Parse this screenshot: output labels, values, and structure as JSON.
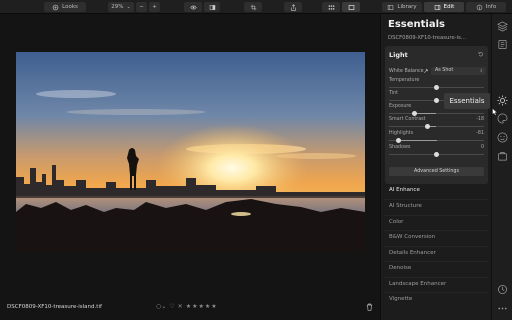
{
  "toolbar": {
    "looks_label": "Looks",
    "zoom_label": "29%",
    "zoom_caret": "⌄",
    "zoom_minus": "−",
    "zoom_plus": "+",
    "library_label": "Library",
    "edit_label": "Edit",
    "info_label": "Info"
  },
  "image": {
    "filename": "DSCF0809-XF10-treasure-island.tif",
    "rating_stars": "★★★★★",
    "rating_value": 0
  },
  "panel": {
    "title": "Essentials",
    "subtitle": "DSCF0809-XF10-treasure-is...",
    "card": {
      "title": "Light",
      "white_balance_label": "White Balance",
      "white_balance_value": "As Shot",
      "sliders": [
        {
          "label": "Temperature",
          "value": "",
          "level": 0.5
        },
        {
          "label": "Tint",
          "value": "",
          "level": 0.5
        },
        {
          "label": "Exposure",
          "value": "",
          "level": 0.27
        },
        {
          "label": "Smart Contrast",
          "value": "-18",
          "level": 0.41
        },
        {
          "label": "Highlights",
          "value": "-81",
          "level": 0.1
        },
        {
          "label": "Shadows",
          "value": "0",
          "level": 0.5
        }
      ],
      "advanced_label": "Advanced Settings"
    },
    "tools": [
      "AI Enhance",
      "AI Structure",
      "Color",
      "B&W Conversion",
      "Details Enhancer",
      "Denoise",
      "Landscape Enhancer",
      "Vignette"
    ],
    "active_tool": "AI Enhance"
  },
  "tooltip": {
    "text": "Essentials"
  },
  "colors": {
    "accent": "#e0e0e0",
    "panel_bg": "#1c1c1c",
    "card_bg": "#2a2a2a"
  }
}
